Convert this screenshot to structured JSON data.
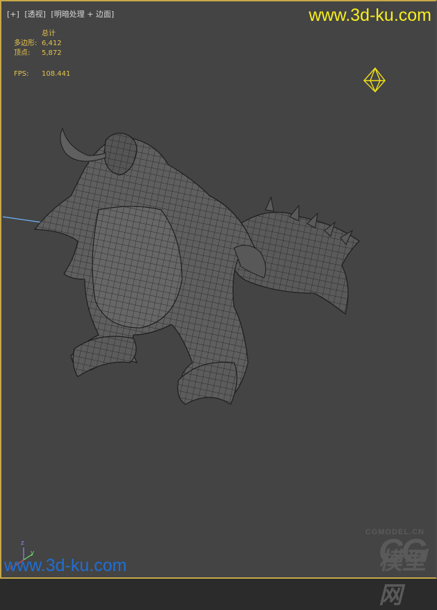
{
  "viewport": {
    "labels": [
      "[+]",
      "[透视]",
      "[明暗处理 + 边面]"
    ]
  },
  "stats": {
    "header": "总计",
    "polygons_label": "多边形:",
    "polygons_value": "6,412",
    "vertices_label": "顶点:",
    "vertices_value": "5,872",
    "fps_label": "FPS:",
    "fps_value": "108.441"
  },
  "watermarks": {
    "top": "www.3d-ku.com",
    "bottom": "www.3d-ku.com",
    "logo_site": "CGMODEL.CN",
    "logo_cg": "CG",
    "logo_cn": "模型网"
  },
  "axis": {
    "x": "x",
    "y": "y",
    "z": "z"
  },
  "colors": {
    "viewport_bg": "#444444",
    "active_border": "#c8a94a",
    "stats_text": "#e6c34c",
    "watermark_top": "#f7ee1f",
    "watermark_bottom": "#1e6fd6",
    "wire": "#1a1a1a",
    "mesh_fill": "#5f5f5f"
  },
  "icons": [
    "light-gizmo-icon",
    "axis-tripod-icon"
  ]
}
